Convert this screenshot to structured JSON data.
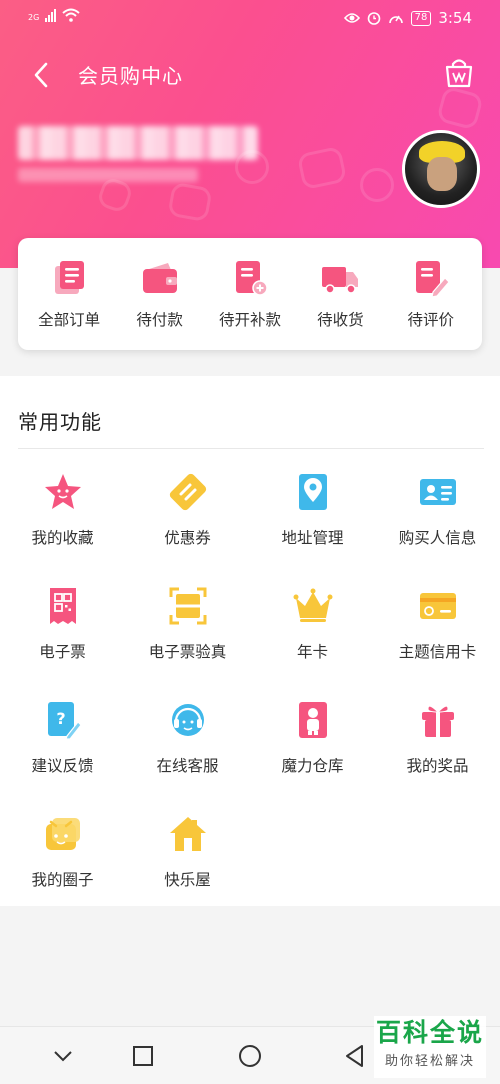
{
  "status_bar": {
    "network": "2G",
    "battery": "78",
    "time": "3:54"
  },
  "header": {
    "title": "会员购中心"
  },
  "orders": [
    {
      "label": "全部订单",
      "icon": "order-list-icon"
    },
    {
      "label": "待付款",
      "icon": "wallet-icon"
    },
    {
      "label": "待开补款",
      "icon": "document-plus-icon"
    },
    {
      "label": "待收货",
      "icon": "delivery-truck-icon"
    },
    {
      "label": "待评价",
      "icon": "document-edit-icon"
    }
  ],
  "functions": {
    "title": "常用功能",
    "items": [
      {
        "label": "我的收藏",
        "icon": "star-icon"
      },
      {
        "label": "优惠券",
        "icon": "coupon-icon"
      },
      {
        "label": "地址管理",
        "icon": "location-pin-icon"
      },
      {
        "label": "购买人信息",
        "icon": "id-card-icon"
      },
      {
        "label": "电子票",
        "icon": "qr-ticket-icon"
      },
      {
        "label": "电子票验真",
        "icon": "scan-icon"
      },
      {
        "label": "年卡",
        "icon": "crown-icon"
      },
      {
        "label": "主题信用卡",
        "icon": "credit-card-icon"
      },
      {
        "label": "建议反馈",
        "icon": "feedback-icon"
      },
      {
        "label": "在线客服",
        "icon": "customer-service-icon"
      },
      {
        "label": "魔力仓库",
        "icon": "warehouse-icon"
      },
      {
        "label": "我的奖品",
        "icon": "gift-icon"
      },
      {
        "label": "我的圈子",
        "icon": "circle-icon"
      },
      {
        "label": "快乐屋",
        "icon": "house-icon"
      }
    ]
  },
  "watermark": {
    "title": "百科全说",
    "subtitle": "助你轻松解决"
  },
  "colors": {
    "pink": "#f5557f",
    "yellow": "#f8c63a",
    "blue": "#3fb8ea",
    "header_start": "#fb5e85",
    "header_end": "#f84ab0"
  }
}
